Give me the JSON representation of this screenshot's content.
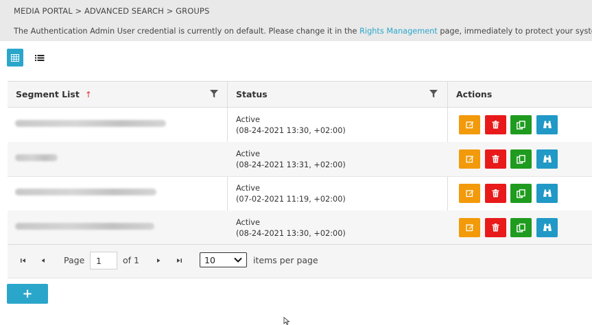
{
  "breadcrumb": "MEDIA PORTAL > ADVANCED SEARCH > GROUPS",
  "notice": {
    "before": "The Authentication Admin User credential is currently on default. Please change it in the ",
    "link": "Rights Management",
    "after": " page, immediately to protect your system."
  },
  "colors": {
    "accent": "#2ba6cb",
    "edit": "#f29a0a",
    "delete": "#e81a1a",
    "copy": "#1f9b1f",
    "view": "#2099c6",
    "sort": "#e03030"
  },
  "view_toggle": {
    "grid_icon": "grid-view-icon",
    "list_icon": "list-view-icon"
  },
  "table": {
    "columns": {
      "segment": {
        "label": "Segment List",
        "sort_icon": "↑"
      },
      "status": {
        "label": "Status"
      },
      "actions": {
        "label": "Actions"
      }
    },
    "rows": [
      {
        "status": "Active",
        "timestamp": "(08-24-2021 13:30, +02:00)"
      },
      {
        "status": "Active",
        "timestamp": "(08-24-2021 13:31, +02:00)"
      },
      {
        "status": "Active",
        "timestamp": "(07-02-2021 11:19, +02:00)"
      },
      {
        "status": "Active",
        "timestamp": "(08-24-2021 13:30, +02:00)"
      }
    ],
    "action_icons": [
      "edit-icon",
      "delete-icon",
      "copy-icon",
      "binoculars-icon"
    ]
  },
  "pager": {
    "page_label": "Page",
    "page_value": "1",
    "of_label": "of 1",
    "page_size": "10",
    "items_per_page": "items per page"
  },
  "add_button": {
    "label": "+"
  }
}
